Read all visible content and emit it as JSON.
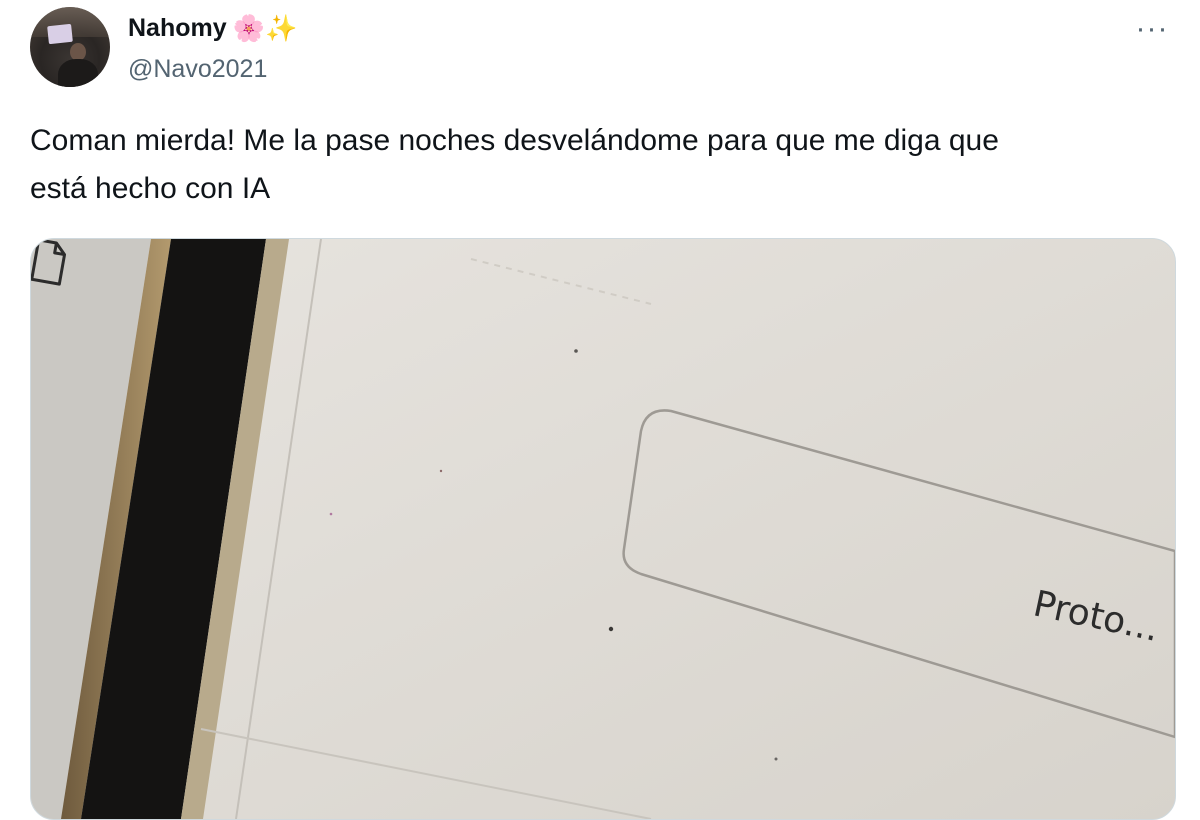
{
  "tweet": {
    "author": {
      "display_name": "Nahomy",
      "emojis": "🌸✨",
      "handle": "@Navo2021"
    },
    "more_icon": "more-horizontal-icon",
    "text_line1": "Coman mierda! Me la pase noches desvelándome para que me diga que",
    "text_line2": "está hecho con IA",
    "media": {
      "file_label": "Proto...",
      "file_icon": "document-icon"
    }
  }
}
